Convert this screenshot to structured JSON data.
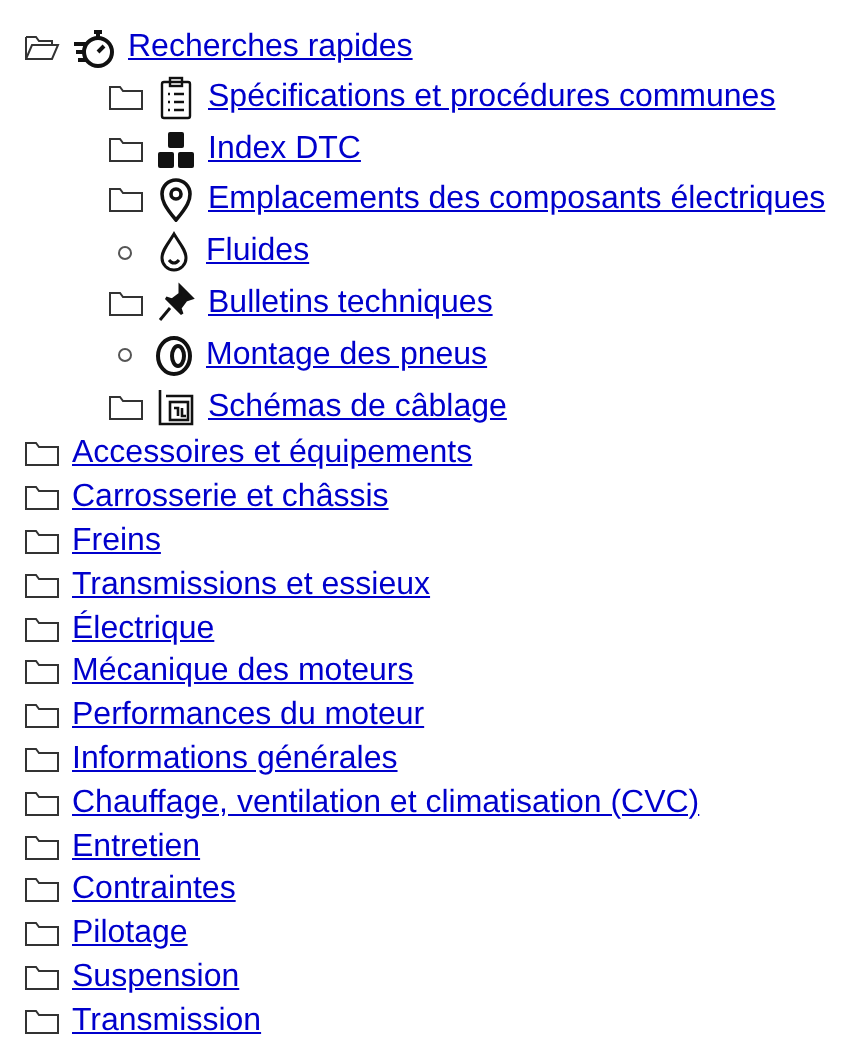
{
  "tree": [
    {
      "label": "Recherches rapides",
      "kind": "folder",
      "expanded": true,
      "children": [
        {
          "label": "Spécifications et procédures communes",
          "kind": "folder",
          "expanded": false
        },
        {
          "label": "Index DTC",
          "kind": "folder",
          "expanded": false
        },
        {
          "label": "Emplacements des composants électriques",
          "kind": "folder",
          "expanded": false
        },
        {
          "label": "Fluides",
          "kind": "leaf"
        },
        {
          "label": "Bulletins techniques",
          "kind": "folder",
          "expanded": false
        },
        {
          "label": "Montage des pneus",
          "kind": "leaf"
        },
        {
          "label": "Schémas de câblage",
          "kind": "folder",
          "expanded": false
        }
      ]
    },
    {
      "label": "Accessoires et équipements",
      "kind": "folder",
      "expanded": false
    },
    {
      "label": "Carrosserie et châssis",
      "kind": "folder",
      "expanded": false
    },
    {
      "label": "Freins",
      "kind": "folder",
      "expanded": false
    },
    {
      "label": "Transmissions et essieux",
      "kind": "folder",
      "expanded": false
    },
    {
      "label": "Électrique",
      "kind": "folder",
      "expanded": false
    },
    {
      "label": "Mécanique des moteurs",
      "kind": "folder",
      "expanded": false
    },
    {
      "label": "Performances du moteur",
      "kind": "folder",
      "expanded": false
    },
    {
      "label": "Informations générales",
      "kind": "folder",
      "expanded": false
    },
    {
      "label": "Chauffage, ventilation et climatisation (CVC)",
      "kind": "folder",
      "expanded": false
    },
    {
      "label": "Entretien",
      "kind": "folder",
      "expanded": false
    },
    {
      "label": "Contraintes",
      "kind": "folder",
      "expanded": false
    },
    {
      "label": "Pilotage",
      "kind": "folder",
      "expanded": false
    },
    {
      "label": "Suspension",
      "kind": "folder",
      "expanded": false
    },
    {
      "label": "Transmission",
      "kind": "folder",
      "expanded": false
    }
  ]
}
